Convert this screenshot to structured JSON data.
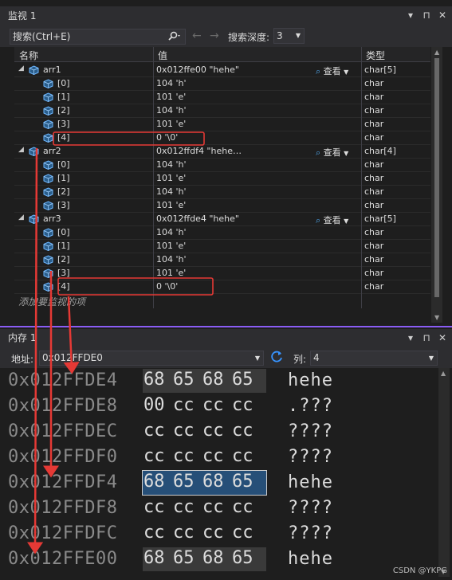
{
  "watch": {
    "title": "监视 1",
    "title_buttons": [
      "▾",
      "⊓",
      "✕"
    ],
    "search_placeholder": "搜索(Ctrl+E)",
    "search_depth_label": "搜索深度:",
    "search_depth_value": "3",
    "headers": {
      "name": "名称",
      "value": "值",
      "type": "类型"
    },
    "view_label": "查看",
    "rows": [
      {
        "name": "arr1",
        "value": "0x012ffe00 \"hehe\"",
        "type": "char[5]",
        "level": 0,
        "expander": true,
        "view": true
      },
      {
        "name": "[0]",
        "value": "104 'h'",
        "type": "char",
        "level": 1
      },
      {
        "name": "[1]",
        "value": "101 'e'",
        "type": "char",
        "level": 1
      },
      {
        "name": "[2]",
        "value": "104 'h'",
        "type": "char",
        "level": 1
      },
      {
        "name": "[3]",
        "value": "101 'e'",
        "type": "char",
        "level": 1
      },
      {
        "name": "[4]",
        "value": "0 '\\0'",
        "type": "char",
        "level": 1
      },
      {
        "name": "arr2",
        "value": "0x012ffdf4 \"hehe…",
        "type": "char[4]",
        "level": 0,
        "expander": true,
        "view": true
      },
      {
        "name": "[0]",
        "value": "104 'h'",
        "type": "char",
        "level": 1
      },
      {
        "name": "[1]",
        "value": "101 'e'",
        "type": "char",
        "level": 1
      },
      {
        "name": "[2]",
        "value": "104 'h'",
        "type": "char",
        "level": 1
      },
      {
        "name": "[3]",
        "value": "101 'e'",
        "type": "char",
        "level": 1
      },
      {
        "name": "arr3",
        "value": "0x012ffde4 \"hehe\"",
        "type": "char[5]",
        "level": 0,
        "expander": true,
        "view": true
      },
      {
        "name": "[0]",
        "value": "104 'h'",
        "type": "char",
        "level": 1
      },
      {
        "name": "[1]",
        "value": "101 'e'",
        "type": "char",
        "level": 1
      },
      {
        "name": "[2]",
        "value": "104 'h'",
        "type": "char",
        "level": 1
      },
      {
        "name": "[3]",
        "value": "101 'e'",
        "type": "char",
        "level": 1
      },
      {
        "name": "[4]",
        "value": "0 '\\0'",
        "type": "char",
        "level": 1
      }
    ],
    "add_watch": "添加要监视的项"
  },
  "memory": {
    "title": "内存 1",
    "address_label": "地址:",
    "address_value": "0x012FFDE0",
    "columns_label": "列:",
    "columns_value": "4",
    "rows": [
      {
        "addr": "0x012FFDE4",
        "bytes": [
          "68",
          "65",
          "68",
          "65"
        ],
        "ascii": "hehe",
        "hl": "gray"
      },
      {
        "addr": "0x012FFDE8",
        "bytes": [
          "00",
          "cc",
          "cc",
          "cc"
        ],
        "ascii": ".???",
        "hl": ""
      },
      {
        "addr": "0x012FFDEC",
        "bytes": [
          "cc",
          "cc",
          "cc",
          "cc"
        ],
        "ascii": "????",
        "hl": ""
      },
      {
        "addr": "0x012FFDF0",
        "bytes": [
          "cc",
          "cc",
          "cc",
          "cc"
        ],
        "ascii": "????",
        "hl": ""
      },
      {
        "addr": "0x012FFDF4",
        "bytes": [
          "68",
          "65",
          "68",
          "65"
        ],
        "ascii": "hehe",
        "hl": "blue"
      },
      {
        "addr": "0x012FFDF8",
        "bytes": [
          "cc",
          "cc",
          "cc",
          "cc"
        ],
        "ascii": "????",
        "hl": ""
      },
      {
        "addr": "0x012FFDFC",
        "bytes": [
          "cc",
          "cc",
          "cc",
          "cc"
        ],
        "ascii": "????",
        "hl": ""
      },
      {
        "addr": "0x012FFE00",
        "bytes": [
          "68",
          "65",
          "68",
          "65"
        ],
        "ascii": "hehe",
        "hl": "gray"
      }
    ]
  },
  "watermark": "CSDN @YKPG",
  "colors": {
    "annotation": "#e53935",
    "accent": "#8a5cf5",
    "selection": "#264f78"
  }
}
